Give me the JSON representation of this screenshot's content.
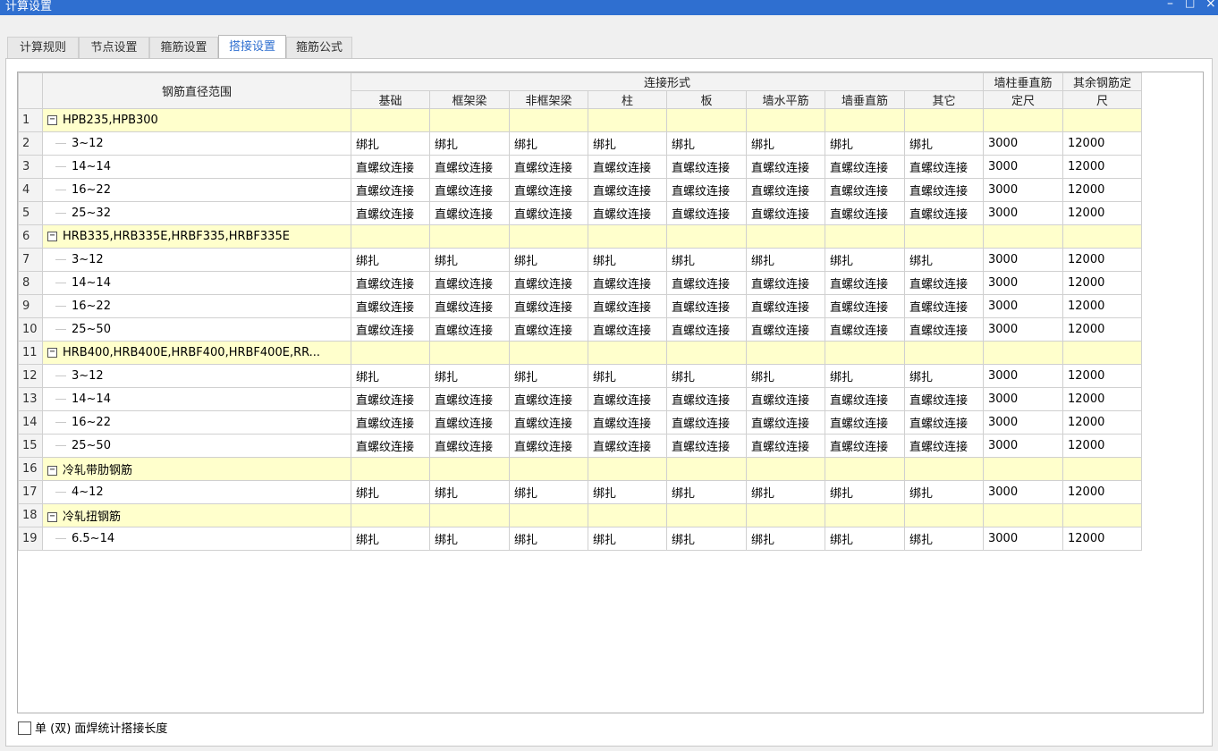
{
  "window": {
    "title": "计算设置",
    "minimize": "–",
    "maximize": "□",
    "close": "×"
  },
  "tabs": [
    {
      "label": "计算规则",
      "active": false
    },
    {
      "label": "节点设置",
      "active": false
    },
    {
      "label": "箍筋设置",
      "active": false
    },
    {
      "label": "搭接设置",
      "active": true
    },
    {
      "label": "箍筋公式",
      "active": false
    }
  ],
  "grid": {
    "header": {
      "diameter_range": "钢筋直径范围",
      "connection_type": "连接形式",
      "columns": [
        "基础",
        "框架梁",
        "非框架梁",
        "柱",
        "板",
        "墙水平筋",
        "墙垂直筋",
        "其它"
      ],
      "wall_col_vertical_line1": "墙柱垂直筋",
      "wall_col_vertical_line2": "定尺",
      "other_rebar_line1": "其余钢筋定",
      "other_rebar_line2": "尺"
    },
    "rows": [
      {
        "num": "1",
        "group": true,
        "name": "HPB235,HPB300"
      },
      {
        "num": "2",
        "group": false,
        "name": "3~12",
        "conn": [
          "绑扎",
          "绑扎",
          "绑扎",
          "绑扎",
          "绑扎",
          "绑扎",
          "绑扎",
          "绑扎"
        ],
        "wall_len": "3000",
        "other_len": "12000"
      },
      {
        "num": "3",
        "group": false,
        "name": "14~14",
        "conn": [
          "直螺纹连接",
          "直螺纹连接",
          "直螺纹连接",
          "直螺纹连接",
          "直螺纹连接",
          "直螺纹连接",
          "直螺纹连接",
          "直螺纹连接"
        ],
        "wall_len": "3000",
        "other_len": "12000"
      },
      {
        "num": "4",
        "group": false,
        "name": "16~22",
        "conn": [
          "直螺纹连接",
          "直螺纹连接",
          "直螺纹连接",
          "直螺纹连接",
          "直螺纹连接",
          "直螺纹连接",
          "直螺纹连接",
          "直螺纹连接"
        ],
        "wall_len": "3000",
        "other_len": "12000"
      },
      {
        "num": "5",
        "group": false,
        "name": "25~32",
        "conn": [
          "直螺纹连接",
          "直螺纹连接",
          "直螺纹连接",
          "直螺纹连接",
          "直螺纹连接",
          "直螺纹连接",
          "直螺纹连接",
          "直螺纹连接"
        ],
        "wall_len": "3000",
        "other_len": "12000"
      },
      {
        "num": "6",
        "group": true,
        "name": "HRB335,HRB335E,HRBF335,HRBF335E"
      },
      {
        "num": "7",
        "group": false,
        "name": "3~12",
        "conn": [
          "绑扎",
          "绑扎",
          "绑扎",
          "绑扎",
          "绑扎",
          "绑扎",
          "绑扎",
          "绑扎"
        ],
        "wall_len": "3000",
        "other_len": "12000"
      },
      {
        "num": "8",
        "group": false,
        "name": "14~14",
        "conn": [
          "直螺纹连接",
          "直螺纹连接",
          "直螺纹连接",
          "直螺纹连接",
          "直螺纹连接",
          "直螺纹连接",
          "直螺纹连接",
          "直螺纹连接"
        ],
        "wall_len": "3000",
        "other_len": "12000"
      },
      {
        "num": "9",
        "group": false,
        "name": "16~22",
        "conn": [
          "直螺纹连接",
          "直螺纹连接",
          "直螺纹连接",
          "直螺纹连接",
          "直螺纹连接",
          "直螺纹连接",
          "直螺纹连接",
          "直螺纹连接"
        ],
        "wall_len": "3000",
        "other_len": "12000"
      },
      {
        "num": "10",
        "group": false,
        "name": "25~50",
        "conn": [
          "直螺纹连接",
          "直螺纹连接",
          "直螺纹连接",
          "直螺纹连接",
          "直螺纹连接",
          "直螺纹连接",
          "直螺纹连接",
          "直螺纹连接"
        ],
        "wall_len": "3000",
        "other_len": "12000"
      },
      {
        "num": "11",
        "group": true,
        "name": "HRB400,HRB400E,HRBF400,HRBF400E,RR..."
      },
      {
        "num": "12",
        "group": false,
        "name": "3~12",
        "conn": [
          "绑扎",
          "绑扎",
          "绑扎",
          "绑扎",
          "绑扎",
          "绑扎",
          "绑扎",
          "绑扎"
        ],
        "wall_len": "3000",
        "other_len": "12000"
      },
      {
        "num": "13",
        "group": false,
        "name": "14~14",
        "conn": [
          "直螺纹连接",
          "直螺纹连接",
          "直螺纹连接",
          "直螺纹连接",
          "直螺纹连接",
          "直螺纹连接",
          "直螺纹连接",
          "直螺纹连接"
        ],
        "wall_len": "3000",
        "other_len": "12000"
      },
      {
        "num": "14",
        "group": false,
        "name": "16~22",
        "conn": [
          "直螺纹连接",
          "直螺纹连接",
          "直螺纹连接",
          "直螺纹连接",
          "直螺纹连接",
          "直螺纹连接",
          "直螺纹连接",
          "直螺纹连接"
        ],
        "wall_len": "3000",
        "other_len": "12000"
      },
      {
        "num": "15",
        "group": false,
        "name": "25~50",
        "conn": [
          "直螺纹连接",
          "直螺纹连接",
          "直螺纹连接",
          "直螺纹连接",
          "直螺纹连接",
          "直螺纹连接",
          "直螺纹连接",
          "直螺纹连接"
        ],
        "wall_len": "3000",
        "other_len": "12000"
      },
      {
        "num": "16",
        "group": true,
        "name": "冷轧带肋钢筋"
      },
      {
        "num": "17",
        "group": false,
        "name": "4~12",
        "conn": [
          "绑扎",
          "绑扎",
          "绑扎",
          "绑扎",
          "绑扎",
          "绑扎",
          "绑扎",
          "绑扎"
        ],
        "wall_len": "3000",
        "other_len": "12000"
      },
      {
        "num": "18",
        "group": true,
        "name": "冷轧扭钢筋"
      },
      {
        "num": "19",
        "group": false,
        "name": "6.5~14",
        "conn": [
          "绑扎",
          "绑扎",
          "绑扎",
          "绑扎",
          "绑扎",
          "绑扎",
          "绑扎",
          "绑扎"
        ],
        "wall_len": "3000",
        "other_len": "12000"
      }
    ]
  },
  "footer": {
    "checkbox_label": "单 (双) 面焊统计搭接长度",
    "checked": false
  },
  "colors": {
    "titlebar": "#2f6fd0",
    "group_row": "#ffffcc",
    "active_tab_text": "#2f6fd0"
  }
}
